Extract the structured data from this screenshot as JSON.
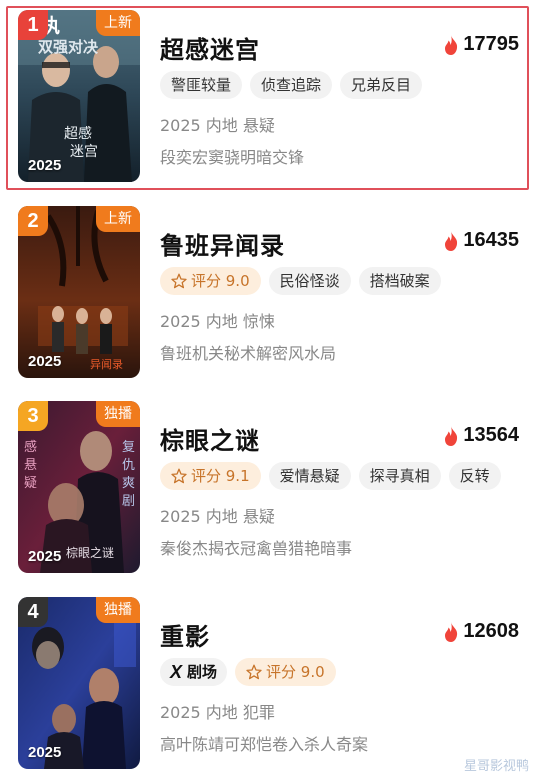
{
  "items": [
    {
      "rank": "1",
      "badge": "上新",
      "title": "超感迷宫",
      "heat": "17795",
      "chips": [
        "警匪较量",
        "侦查追踪",
        "兄弟反目"
      ],
      "meta": "2025 内地 悬疑",
      "desc": "段奕宏窦骁明暗交锋",
      "poster_year": "2025",
      "poster_title": "超感\n迷宫",
      "poster_banner": "恶执 双强对决",
      "rank_color": "#e8423a"
    },
    {
      "rank": "2",
      "badge": "上新",
      "title": "鲁班异闻录",
      "heat": "16435",
      "score": "评分 9.0",
      "chips": [
        "民俗怪谈",
        "搭档破案"
      ],
      "meta": "2025 内地 惊悚",
      "desc": "鲁班机关秘术解密风水局",
      "poster_year": "2025",
      "poster_title": "异闻录",
      "rank_color": "#f07b1d"
    },
    {
      "rank": "3",
      "badge": "独播",
      "title": "棕眼之谜",
      "heat": "13564",
      "score": "评分 9.1",
      "chips": [
        "爱情悬疑",
        "探寻真相",
        "反转"
      ],
      "meta": "2025 内地 悬疑",
      "desc": "秦俊杰揭衣冠禽兽猎艳暗事",
      "poster_year": "2025",
      "poster_title": "棕眼之谜",
      "poster_side": "感悬疑",
      "poster_side2": "复仇爽剧",
      "rank_color": "#f5a623"
    },
    {
      "rank": "4",
      "badge": "独播",
      "title": "重影",
      "heat": "12608",
      "brand": "剧场",
      "score": "评分 9.0",
      "meta": "2025 内地 犯罪",
      "desc": "高叶陈靖可郑恺卷入杀人奇案",
      "poster_year": "2025",
      "rank_color": "#333333"
    }
  ],
  "watermark": "星哥影视鸭",
  "colors": {
    "accent_orange": "#f07b1d",
    "heat_red": "#f0443a",
    "score_bg": "#fdeedd",
    "highlight_border": "#e0505a"
  }
}
